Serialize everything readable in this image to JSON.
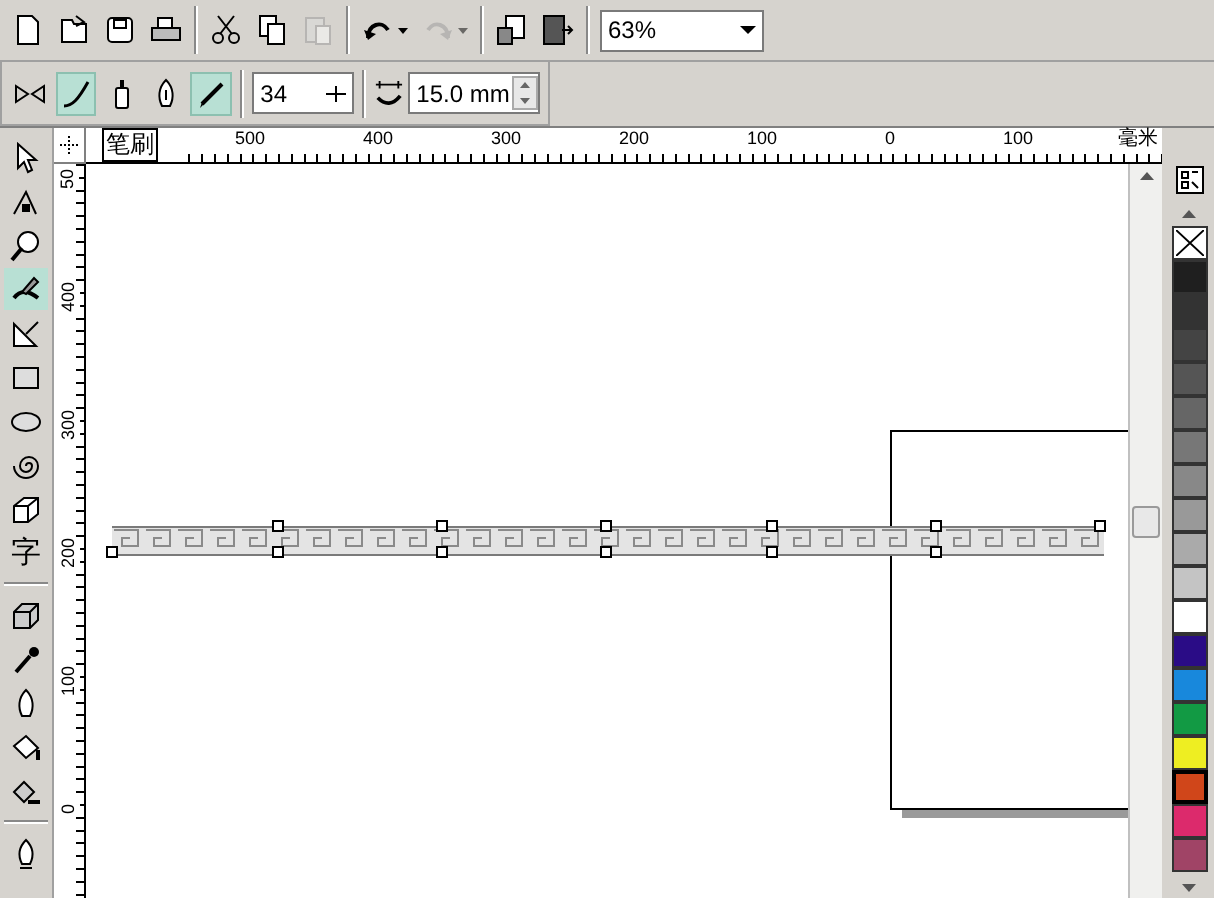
{
  "standard_toolbar": {
    "buttons": [
      {
        "kind": "new",
        "disabled": false
      },
      {
        "kind": "open",
        "disabled": false
      },
      {
        "kind": "save",
        "disabled": false
      },
      {
        "kind": "print",
        "disabled": false
      },
      {
        "kind": "separator"
      },
      {
        "kind": "cut",
        "disabled": false
      },
      {
        "kind": "copy",
        "disabled": false
      },
      {
        "kind": "paste",
        "disabled": true
      },
      {
        "kind": "separator"
      },
      {
        "kind": "undo",
        "disabled": false
      },
      {
        "kind": "redo",
        "disabled": true
      },
      {
        "kind": "separator"
      },
      {
        "kind": "import",
        "disabled": false
      },
      {
        "kind": "export",
        "disabled": false
      },
      {
        "kind": "separator"
      }
    ],
    "zoom": {
      "value": "63%"
    }
  },
  "property_bar": {
    "modes": [
      {
        "kind": "preset",
        "selected": false
      },
      {
        "kind": "brush",
        "selected": true
      },
      {
        "kind": "sprayer",
        "selected": false
      },
      {
        "kind": "calligraphic",
        "selected": false
      },
      {
        "kind": "pressure",
        "selected": true
      }
    ],
    "stroke_count": {
      "value": "34"
    },
    "width": {
      "value": "15.0 mm"
    }
  },
  "toolbox": [
    {
      "kind": "pick",
      "selected": false
    },
    {
      "kind": "shape",
      "selected": false
    },
    {
      "kind": "zoom",
      "selected": false
    },
    {
      "kind": "artistic",
      "selected": true
    },
    {
      "kind": "dimension",
      "selected": false
    },
    {
      "kind": "rectangle",
      "selected": false
    },
    {
      "kind": "ellipse",
      "selected": false
    },
    {
      "kind": "spiral",
      "selected": false
    },
    {
      "kind": "basic_shapes",
      "selected": false
    },
    {
      "kind": "text",
      "glyph": "字",
      "selected": false
    },
    {
      "kind": "separator"
    },
    {
      "kind": "extrude",
      "selected": false
    },
    {
      "kind": "eyedropper",
      "selected": false
    },
    {
      "kind": "outline",
      "selected": false
    },
    {
      "kind": "fill",
      "selected": false
    },
    {
      "kind": "interactive_fill",
      "selected": false
    },
    {
      "kind": "separator"
    },
    {
      "kind": "pen",
      "selected": false
    }
  ],
  "horizontal_ruler": {
    "tool_label": "笔刷",
    "labels": [
      "500",
      "400",
      "300",
      "200",
      "100",
      "0",
      "100"
    ],
    "unit": "毫米"
  },
  "vertical_ruler": {
    "labels": [
      "50",
      "400",
      "300",
      "200",
      "100",
      "0"
    ]
  },
  "palette": [
    {
      "kind": "none",
      "selected": false
    },
    {
      "kind": "swatch",
      "color": "#1f1f1f",
      "selected": false
    },
    {
      "kind": "swatch",
      "color": "#333333",
      "selected": false
    },
    {
      "kind": "swatch",
      "color": "#444444",
      "selected": false
    },
    {
      "kind": "swatch",
      "color": "#555555",
      "selected": false
    },
    {
      "kind": "swatch",
      "color": "#666666",
      "selected": false
    },
    {
      "kind": "swatch",
      "color": "#777777",
      "selected": false
    },
    {
      "kind": "swatch",
      "color": "#888888",
      "selected": false
    },
    {
      "kind": "swatch",
      "color": "#999999",
      "selected": false
    },
    {
      "kind": "swatch",
      "color": "#aaaaaa",
      "selected": false
    },
    {
      "kind": "swatch",
      "color": "#c4c4c4",
      "selected": false
    },
    {
      "kind": "swatch",
      "color": "#ffffff",
      "selected": false
    },
    {
      "kind": "swatch",
      "color": "#2a0c86",
      "selected": false
    },
    {
      "kind": "swatch",
      "color": "#1888dc",
      "selected": false
    },
    {
      "kind": "swatch",
      "color": "#129a44",
      "selected": false
    },
    {
      "kind": "swatch",
      "color": "#eeee22",
      "selected": false
    },
    {
      "kind": "swatch",
      "color": "#d0461a",
      "selected": true
    },
    {
      "kind": "swatch",
      "color": "#dc2a6c",
      "selected": false
    },
    {
      "kind": "swatch",
      "color": "#a04466",
      "selected": false
    }
  ]
}
